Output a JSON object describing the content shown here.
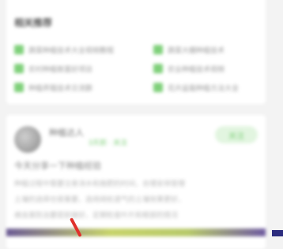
{
  "section": {
    "title": "相关推荐",
    "items_left": [
      "蔬菜种植技术大全视频教程",
      "农村种植致富好项目",
      "种植养殖技术交流群"
    ],
    "items_right": [
      "蔬菜大棚种植技术",
      "农业种植技术视频",
      "花卉盆栽种植方法大全"
    ]
  },
  "post": {
    "author": "种植达人",
    "meta": "3天前 · 关注",
    "follow_label": "关注",
    "title": "今天分享一下种植经验",
    "lines": [
      "种植过程中需要注意浇水和施肥的时间，合理安排管理",
      "土壤的选择也很重要，选用疏松透气的土壤效果更好，",
      "病虫害防治要提前做好，定期检查叶片和根部的情况"
    ]
  },
  "icons": {
    "chevron": "chevron-right-icon",
    "bullet": "green-tag-icon",
    "avatar": "user-avatar"
  },
  "colors": {
    "accent_green": "#7fd07a",
    "background": "#f3f3f3",
    "card": "#ffffff"
  }
}
